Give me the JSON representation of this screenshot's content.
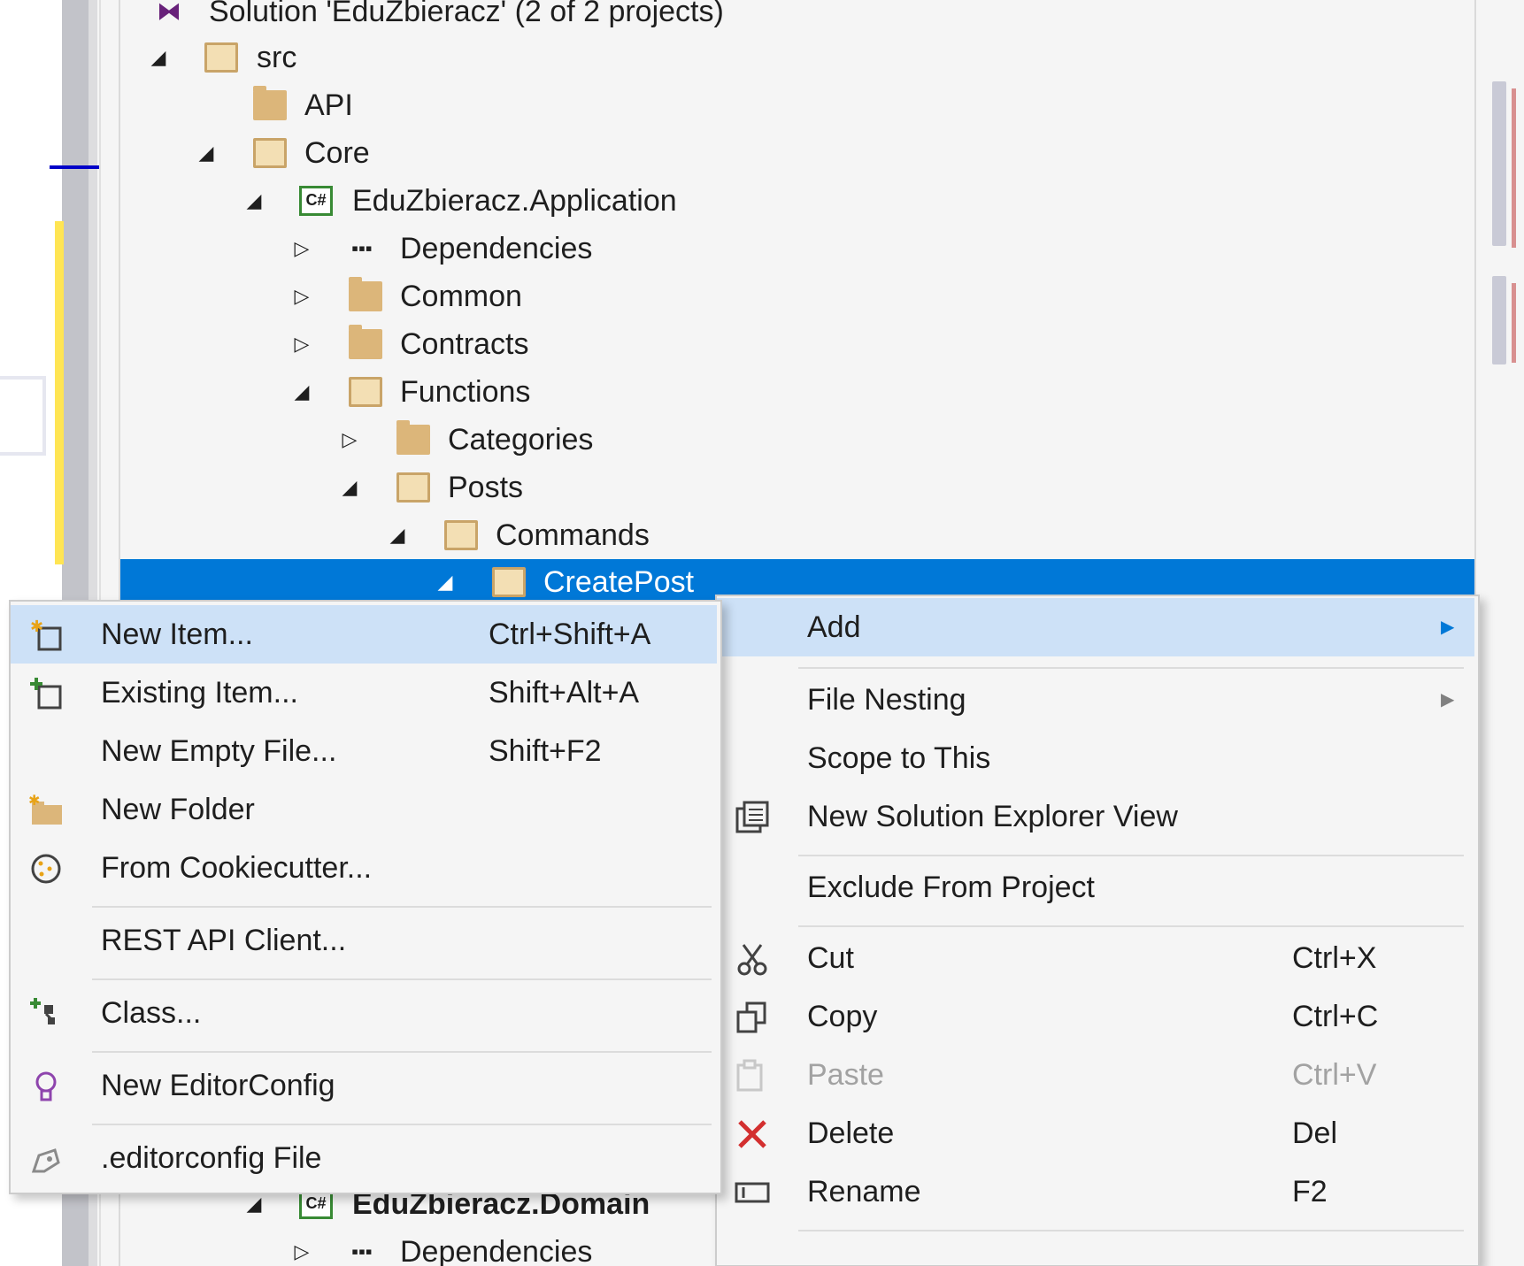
{
  "tree": {
    "solution_label": "Solution 'EduZbieracz' (2 of 2 projects)",
    "items": [
      {
        "label": "src"
      },
      {
        "label": "API"
      },
      {
        "label": "Core"
      },
      {
        "label": "EduZbieracz.Application",
        "icon_text": "C#"
      },
      {
        "label": "Dependencies"
      },
      {
        "label": "Common"
      },
      {
        "label": "Contracts"
      },
      {
        "label": "Functions"
      },
      {
        "label": "Categories"
      },
      {
        "label": "Posts"
      },
      {
        "label": "Commands"
      },
      {
        "label": "CreatePost"
      },
      {
        "label": "EduZbieracz.Domain",
        "icon_text": "C#"
      },
      {
        "label": "Dependencies"
      }
    ]
  },
  "context_menu": {
    "items": [
      {
        "label": "Add",
        "has_submenu": true
      },
      {
        "label": "File Nesting",
        "has_submenu": true
      },
      {
        "label": "Scope to This"
      },
      {
        "label": "New Solution Explorer View"
      },
      {
        "label": "Exclude From Project"
      },
      {
        "label": "Cut",
        "shortcut": "Ctrl+X"
      },
      {
        "label": "Copy",
        "shortcut": "Ctrl+C"
      },
      {
        "label": "Paste",
        "shortcut": "Ctrl+V",
        "disabled": true
      },
      {
        "label": "Delete",
        "shortcut": "Del"
      },
      {
        "label": "Rename",
        "shortcut": "F2"
      }
    ]
  },
  "add_submenu": {
    "items": [
      {
        "label": "New Item...",
        "shortcut": "Ctrl+Shift+A"
      },
      {
        "label": "Existing Item...",
        "shortcut": "Shift+Alt+A"
      },
      {
        "label": "New Empty File...",
        "shortcut": "Shift+F2"
      },
      {
        "label": "New Folder"
      },
      {
        "label": "From Cookiecutter..."
      },
      {
        "label": "REST API Client..."
      },
      {
        "label": "Class..."
      },
      {
        "label": "New EditorConfig"
      },
      {
        "label": ".editorconfig File"
      }
    ]
  },
  "colors": {
    "selection": "#0078d7",
    "menu_highlight": "#cde1f7",
    "folder": "#dcb67a",
    "delete_icon": "#d32f2f"
  },
  "icons": {
    "solution": "visual-studio-solution-icon",
    "folder": "folder-icon",
    "csharp_project": "csharp-project-icon",
    "dependencies": "dependencies-icon",
    "new_item": "new-item-icon",
    "existing_item": "existing-item-icon",
    "new_folder": "new-folder-icon",
    "cookiecutter": "cookiecutter-icon",
    "class": "class-icon",
    "editorconfig": "lightbulb-icon",
    "editorconfig_file": "editorconfig-file-icon",
    "solution_explorer_view": "solution-explorer-view-icon",
    "cut": "scissors-icon",
    "copy": "copy-icon",
    "paste": "paste-icon",
    "delete": "delete-x-icon",
    "rename": "rename-icon"
  }
}
